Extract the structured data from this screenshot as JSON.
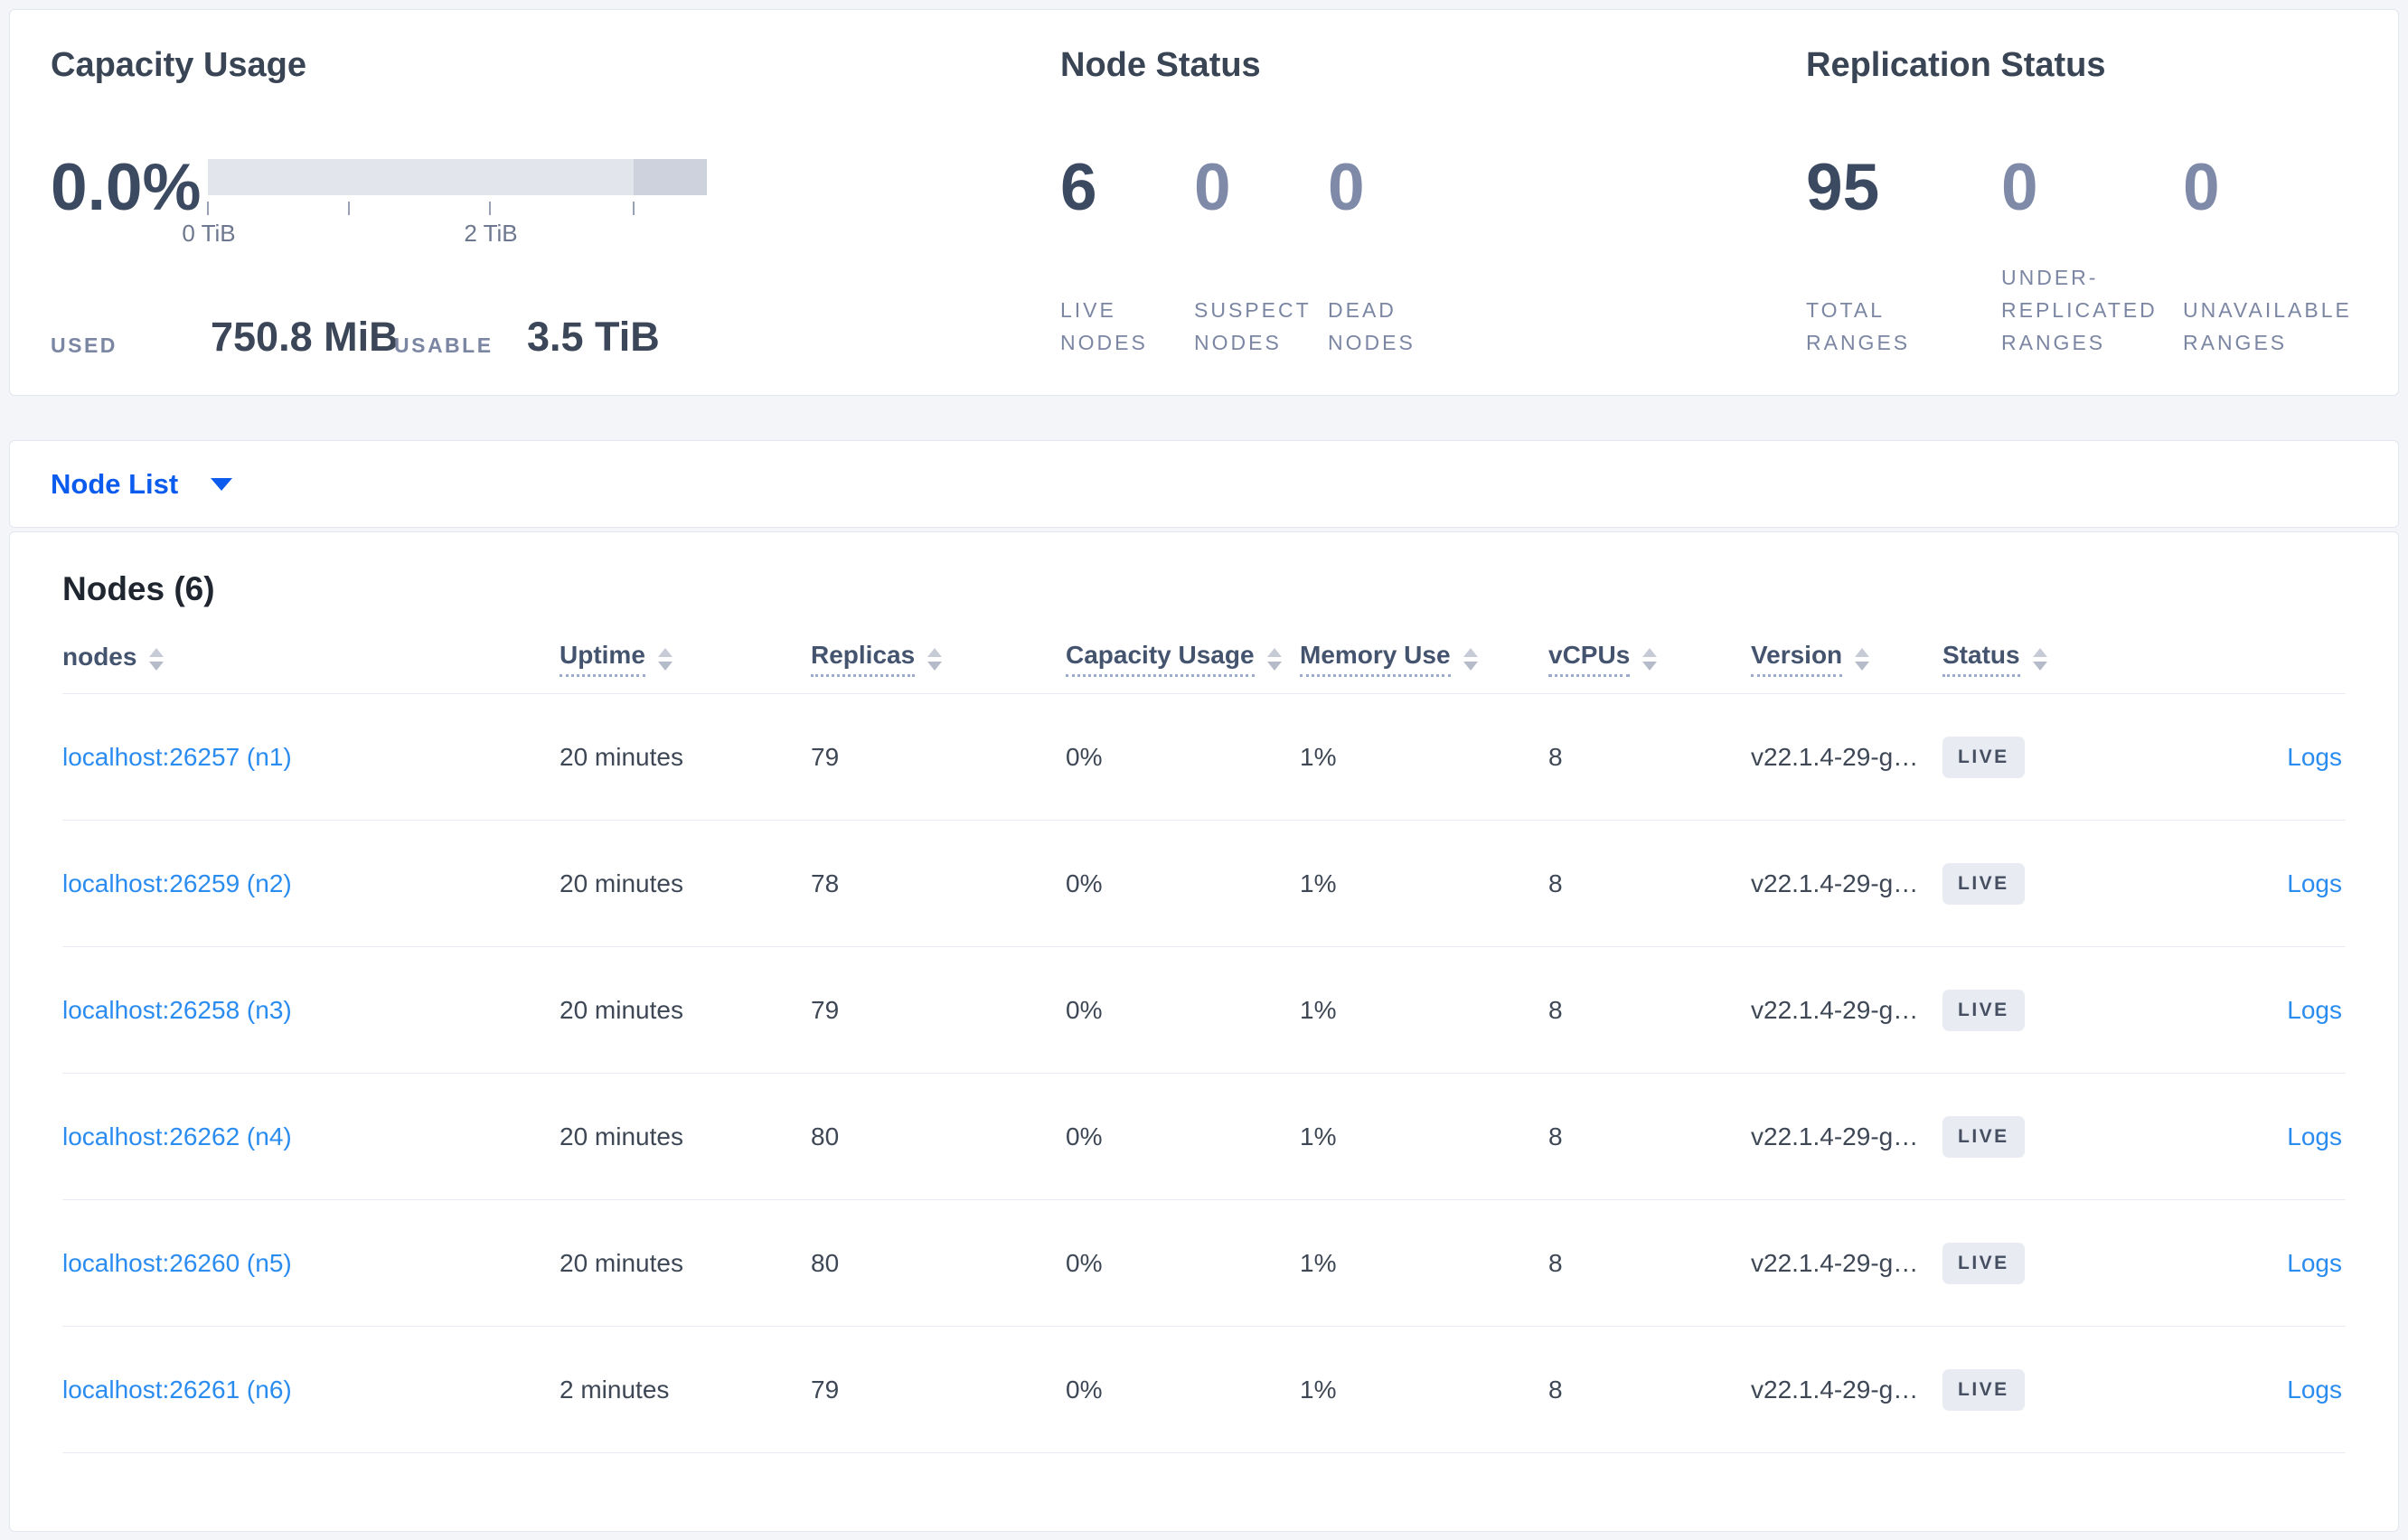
{
  "colors": {
    "accent_blue": "#0b5bee",
    "link_blue": "#2b8cf0",
    "heading": "#394455",
    "muted_label": "#7b86a3",
    "badge_bg": "#e8ebf1",
    "bar_light": "#e3e5ec",
    "bar_dark": "#cdd2dd"
  },
  "summary": {
    "capacity": {
      "title": "Capacity Usage",
      "percent": "0.0%",
      "tick_labels": [
        "0 TiB",
        "2 TiB"
      ],
      "used_label": "USED",
      "used_value": "750.8 MiB",
      "usable_label": "USABLE",
      "usable_value": "3.5 TiB"
    },
    "node_status": {
      "title": "Node Status",
      "stats": [
        {
          "value": "6",
          "label": "LIVE NODES"
        },
        {
          "value": "0",
          "label": "SUSPECT NODES"
        },
        {
          "value": "0",
          "label": "DEAD NODES"
        }
      ]
    },
    "replication": {
      "title": "Replication Status",
      "stats": [
        {
          "value": "95",
          "label": "TOTAL RANGES"
        },
        {
          "value": "0",
          "label": "UNDER-REPLICATED RANGES"
        },
        {
          "value": "0",
          "label": "UNAVAILABLE RANGES"
        }
      ]
    }
  },
  "node_list": {
    "dropdown_label": "Node List"
  },
  "table": {
    "title": "Nodes (6)",
    "columns": [
      "nodes",
      "Uptime",
      "Replicas",
      "Capacity Usage",
      "Memory Use",
      "vCPUs",
      "Version",
      "Status"
    ],
    "rows": [
      {
        "node": "localhost:26257 (n1)",
        "uptime": "20 minutes",
        "replicas": "79",
        "capacity": "0%",
        "memory": "1%",
        "vcpus": "8",
        "version": "v22.1.4-29-g…",
        "status": "LIVE",
        "logs": "Logs"
      },
      {
        "node": "localhost:26259 (n2)",
        "uptime": "20 minutes",
        "replicas": "78",
        "capacity": "0%",
        "memory": "1%",
        "vcpus": "8",
        "version": "v22.1.4-29-g…",
        "status": "LIVE",
        "logs": "Logs"
      },
      {
        "node": "localhost:26258 (n3)",
        "uptime": "20 minutes",
        "replicas": "79",
        "capacity": "0%",
        "memory": "1%",
        "vcpus": "8",
        "version": "v22.1.4-29-g…",
        "status": "LIVE",
        "logs": "Logs"
      },
      {
        "node": "localhost:26262 (n4)",
        "uptime": "20 minutes",
        "replicas": "80",
        "capacity": "0%",
        "memory": "1%",
        "vcpus": "8",
        "version": "v22.1.4-29-g…",
        "status": "LIVE",
        "logs": "Logs"
      },
      {
        "node": "localhost:26260 (n5)",
        "uptime": "20 minutes",
        "replicas": "80",
        "capacity": "0%",
        "memory": "1%",
        "vcpus": "8",
        "version": "v22.1.4-29-g…",
        "status": "LIVE",
        "logs": "Logs"
      },
      {
        "node": "localhost:26261 (n6)",
        "uptime": "2 minutes",
        "replicas": "79",
        "capacity": "0%",
        "memory": "1%",
        "vcpus": "8",
        "version": "v22.1.4-29-g…",
        "status": "LIVE",
        "logs": "Logs"
      }
    ]
  }
}
